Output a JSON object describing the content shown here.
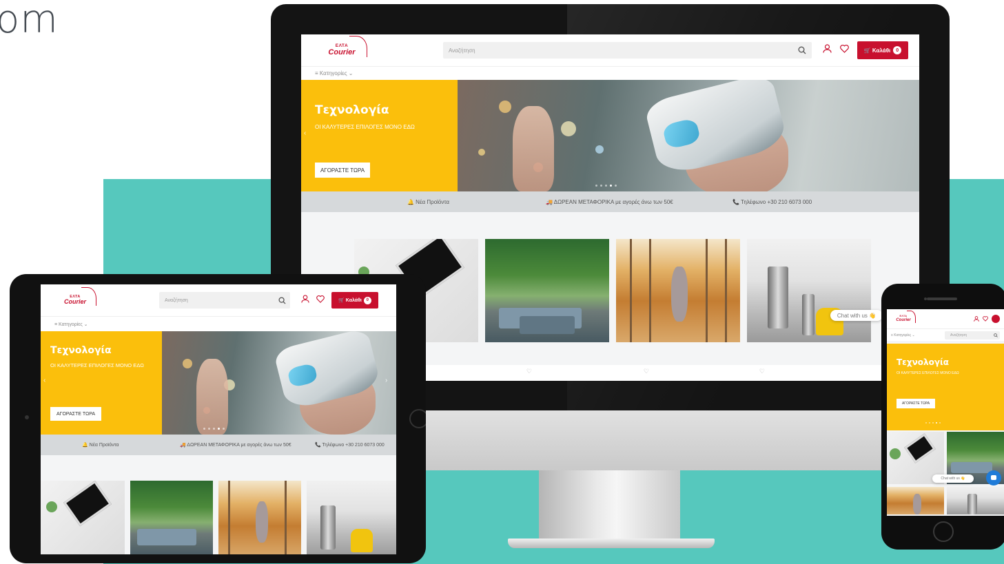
{
  "corner_text": "om",
  "logo": {
    "line1": "ΕΛΤΑ",
    "line2": "Courier"
  },
  "header": {
    "search_placeholder": "Αναζήτηση",
    "cart_label": "🛒 Καλάθι",
    "cart_count": "0"
  },
  "categories_label": "≡  Κατηγορίες  ⌄",
  "hero": {
    "title": "Τεχνολογία",
    "subtitle": "ΟΙ ΚΑΛΥΤΕΡΕΣ ΕΠΙΛΟΓΕΣ ΜΟΝΟ ΕΔΩ",
    "cta": "ΑΓΟΡΑΣΤΕ ΤΩΡΑ"
  },
  "infobar": {
    "new_products": "🔔 Νέα Προϊόντα",
    "shipping": "🚚 ΔΩΡΕΑΝ ΜΕΤΑΦΟΡΙΚΑ με αγορές άνω των 50€",
    "phone": "📞 Τηλέφωνο +30 210 6073 000"
  },
  "chat_label": "Chat with us 👋",
  "colors": {
    "brand_red": "#c8102e",
    "hero_yellow": "#fbbf0c",
    "teal_background": "#56c8bd",
    "info_bar_gray": "#d6d9db"
  },
  "icons": [
    "search-icon",
    "user-icon",
    "heart-icon",
    "cart-icon",
    "bell-icon",
    "truck-icon",
    "phone-icon",
    "menu-icon",
    "chat-icon"
  ]
}
